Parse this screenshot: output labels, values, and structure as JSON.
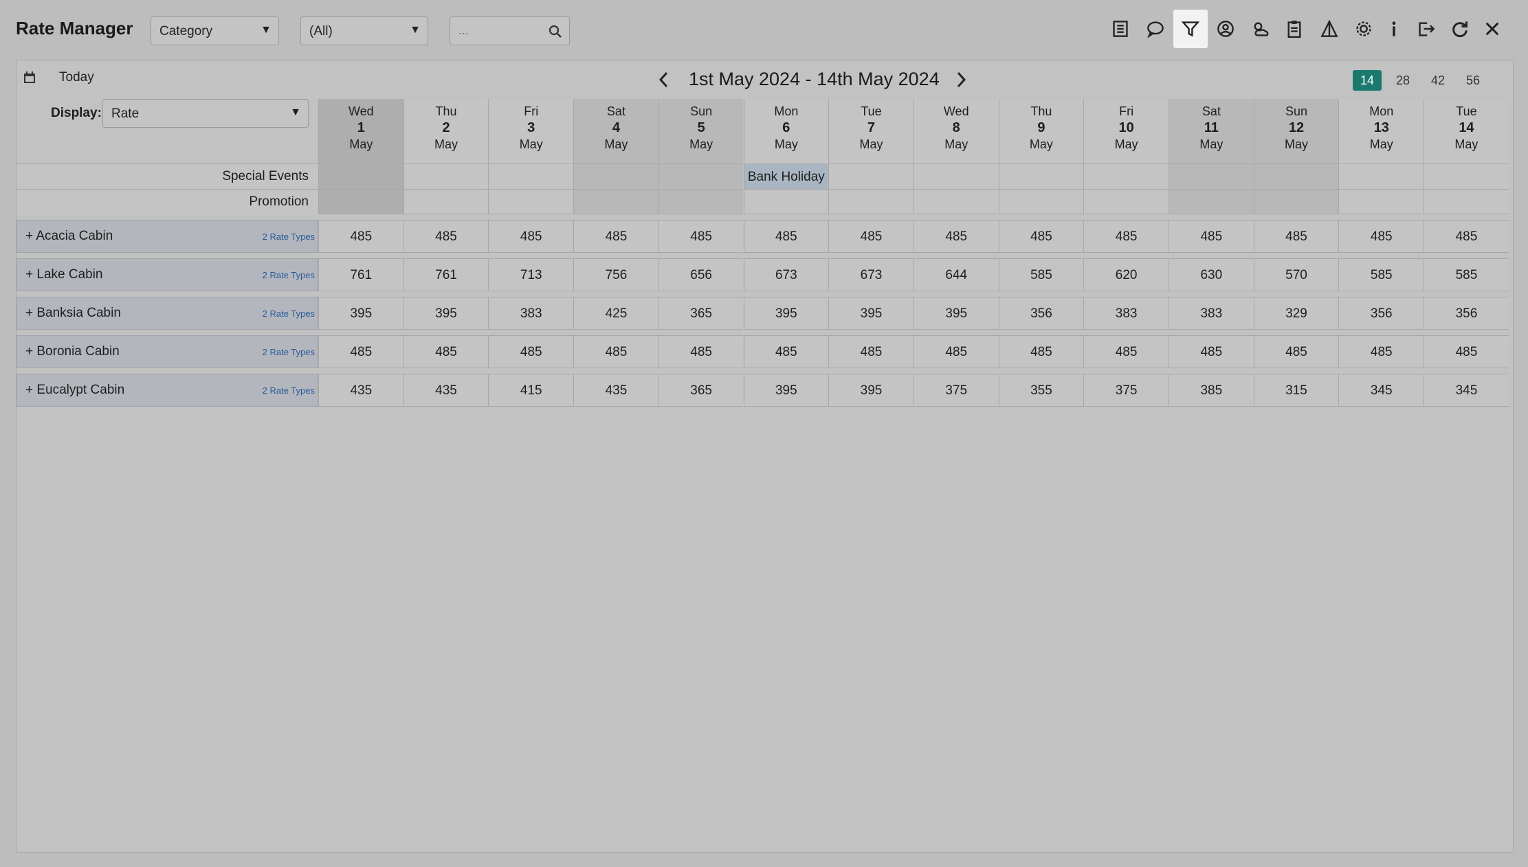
{
  "app": {
    "title": "Rate Manager"
  },
  "filters": {
    "category": "Category",
    "scope": "(All)",
    "search_placeholder": "..."
  },
  "toolbar": [
    "list-icon",
    "chat-icon",
    "filter-icon",
    "user-circle-icon",
    "weather-icon",
    "clipboard-icon",
    "triangle-flag-icon",
    "gear-icon",
    "info-icon",
    "exit-icon",
    "refresh-icon",
    "close-icon"
  ],
  "nav": {
    "today": "Today",
    "range": "1st May 2024 - 14th May 2024",
    "periods": [
      "14",
      "28",
      "42",
      "56"
    ],
    "active_period": "14"
  },
  "display": {
    "label": "Display:",
    "value": "Rate"
  },
  "days": [
    {
      "dow": "Wed",
      "d": "1",
      "m": "May",
      "wk": true
    },
    {
      "dow": "Thu",
      "d": "2",
      "m": "May",
      "wk": false
    },
    {
      "dow": "Fri",
      "d": "3",
      "m": "May",
      "wk": false
    },
    {
      "dow": "Sat",
      "d": "4",
      "m": "May",
      "wk": true
    },
    {
      "dow": "Sun",
      "d": "5",
      "m": "May",
      "wk": true
    },
    {
      "dow": "Mon",
      "d": "6",
      "m": "May",
      "wk": false
    },
    {
      "dow": "Tue",
      "d": "7",
      "m": "May",
      "wk": false
    },
    {
      "dow": "Wed",
      "d": "8",
      "m": "May",
      "wk": false
    },
    {
      "dow": "Thu",
      "d": "9",
      "m": "May",
      "wk": false
    },
    {
      "dow": "Fri",
      "d": "10",
      "m": "May",
      "wk": false
    },
    {
      "dow": "Sat",
      "d": "11",
      "m": "May",
      "wk": true
    },
    {
      "dow": "Sun",
      "d": "12",
      "m": "May",
      "wk": true
    },
    {
      "dow": "Mon",
      "d": "13",
      "m": "May",
      "wk": false
    },
    {
      "dow": "Tue",
      "d": "14",
      "m": "May",
      "wk": false
    }
  ],
  "special_rows": {
    "events_label": "Special Events",
    "promotion_label": "Promotion",
    "events": {
      "5": "Bank Holiday"
    }
  },
  "categories": [
    {
      "name": "Acacia Cabin",
      "rate_types": "2 Rate Types",
      "rates": [
        485,
        485,
        485,
        485,
        485,
        485,
        485,
        485,
        485,
        485,
        485,
        485,
        485,
        485
      ]
    },
    {
      "name": "Lake Cabin",
      "rate_types": "2 Rate Types",
      "rates": [
        761,
        761,
        713,
        756,
        656,
        673,
        673,
        644,
        585,
        620,
        630,
        570,
        585,
        585
      ]
    },
    {
      "name": "Banksia Cabin",
      "rate_types": "2 Rate Types",
      "rates": [
        395,
        395,
        383,
        425,
        365,
        395,
        395,
        395,
        356,
        383,
        383,
        329,
        356,
        356
      ]
    },
    {
      "name": "Boronia Cabin",
      "rate_types": "2 Rate Types",
      "rates": [
        485,
        485,
        485,
        485,
        485,
        485,
        485,
        485,
        485,
        485,
        485,
        485,
        485,
        485
      ]
    },
    {
      "name": "Eucalypt Cabin",
      "rate_types": "2 Rate Types",
      "rates": [
        435,
        435,
        415,
        435,
        365,
        395,
        395,
        375,
        355,
        375,
        385,
        315,
        345,
        345
      ]
    }
  ]
}
